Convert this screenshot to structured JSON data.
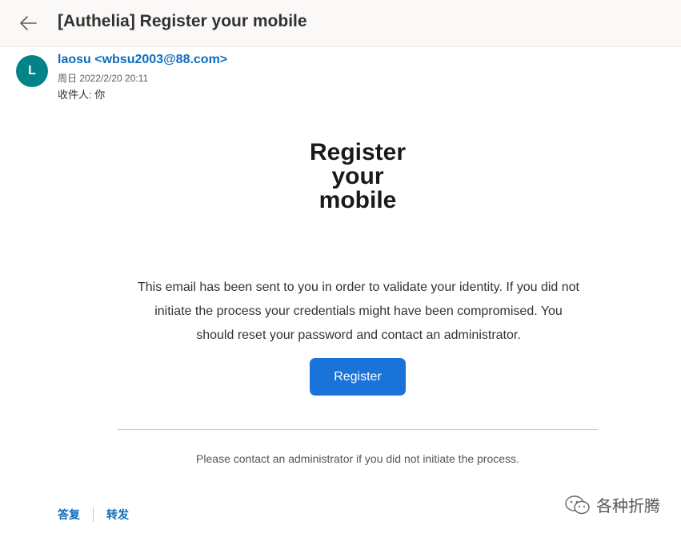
{
  "header": {
    "subject": "[Authelia] Register your mobile",
    "back_icon": "arrow-left-icon"
  },
  "sender": {
    "avatar_initial": "L",
    "avatar_color": "#038387",
    "from": "laosu <wbsu2003@88.com>",
    "date": "周日 2022/2/20 20:11",
    "to": "收件人:  你"
  },
  "email": {
    "title_lines": [
      "Register",
      "your",
      "mobile"
    ],
    "body_lines": [
      "This email has been sent to you in order to validate your identity. If you did not",
      "initiate the process your credentials might have been compromised. You",
      "should reset your password and contact an administrator."
    ],
    "button_label": "Register",
    "button_color": "#1a73d8",
    "footer": "Please contact an administrator if you did not initiate the process."
  },
  "actions": {
    "reply": "答复",
    "forward": "转发"
  },
  "watermark": {
    "text": "各种折腾",
    "icon": "wechat-icon"
  },
  "colors": {
    "link": "#0f6cbd",
    "header_bg": "#faf9f8"
  }
}
